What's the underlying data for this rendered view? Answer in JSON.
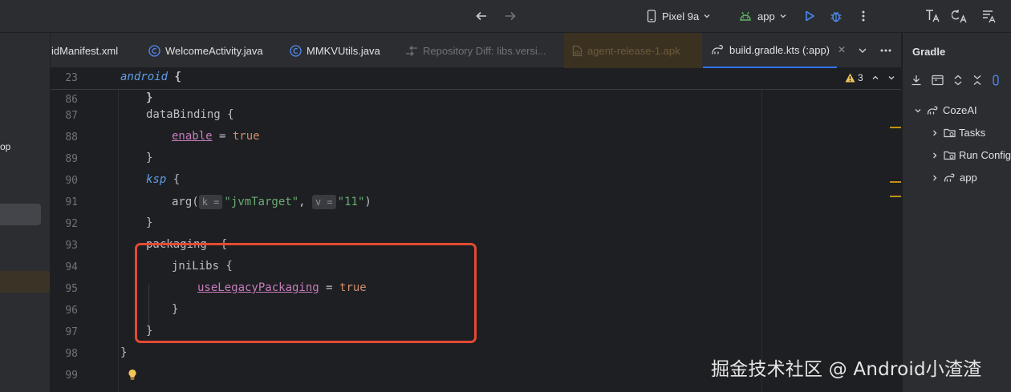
{
  "toolbar": {
    "device": "Pixel 9a",
    "run_config": "app"
  },
  "left_panel": {
    "partial_text": "op"
  },
  "tabs": [
    {
      "label": "idManifest.xml",
      "icon": "xml-file-icon"
    },
    {
      "label": "WelcomeActivity.java",
      "icon": "java-class-icon"
    },
    {
      "label": "MMKVUtils.java",
      "icon": "java-class-icon"
    },
    {
      "label": "Repository Diff: libs.versi...",
      "icon": "diff-icon"
    },
    {
      "label": "agent-release-1.apk",
      "icon": "apk-icon"
    },
    {
      "label": "build.gradle.kts (:app)",
      "icon": "gradle-icon",
      "active": true
    }
  ],
  "editor": {
    "warning_count": "3",
    "sticky": {
      "line": "23",
      "keyword": "android",
      "brace": "{"
    },
    "lines": [
      {
        "n": "86",
        "text": "}"
      },
      {
        "n": "87",
        "text": "dataBinding {"
      },
      {
        "n": "88",
        "prop": "enable",
        "op": " = ",
        "val": "true"
      },
      {
        "n": "89",
        "text": "}"
      },
      {
        "n": "90",
        "kw": "ksp",
        "brace": " {"
      },
      {
        "n": "91",
        "fn": "arg(",
        "hint1": "k =",
        "s1": "\"jvmTarget\"",
        "comma": ", ",
        "hint2": "v =",
        "s2": "\"11\"",
        "close": ")"
      },
      {
        "n": "92",
        "text": "}"
      },
      {
        "n": "93",
        "text": "packaging  {"
      },
      {
        "n": "94",
        "text": "jniLibs {"
      },
      {
        "n": "95",
        "prop": "useLegacyPackaging",
        "op": " = ",
        "val": "true"
      },
      {
        "n": "96",
        "text": "}"
      },
      {
        "n": "97",
        "text": "}"
      },
      {
        "n": "98",
        "text": "}"
      },
      {
        "n": "99",
        "text": ""
      }
    ]
  },
  "gradle_panel": {
    "title": "Gradle",
    "tree": [
      {
        "label": "CozeAI",
        "icon": "gradle-elephant-icon"
      },
      {
        "label": "Tasks",
        "icon": "folder-gear-icon"
      },
      {
        "label": "Run Configu",
        "icon": "folder-gear-icon"
      },
      {
        "label": "app",
        "icon": "gradle-elephant-icon"
      }
    ]
  },
  "watermark": "掘金技术社区 @ Android小渣渣",
  "colors": {
    "accent": "#3574f0",
    "highlight_box": "#e24a33",
    "keyword": "#5f9ee8",
    "property": "#c77dbb",
    "boolean": "#cf8e6d",
    "string": "#6aab73",
    "warning": "#f2c55c"
  }
}
